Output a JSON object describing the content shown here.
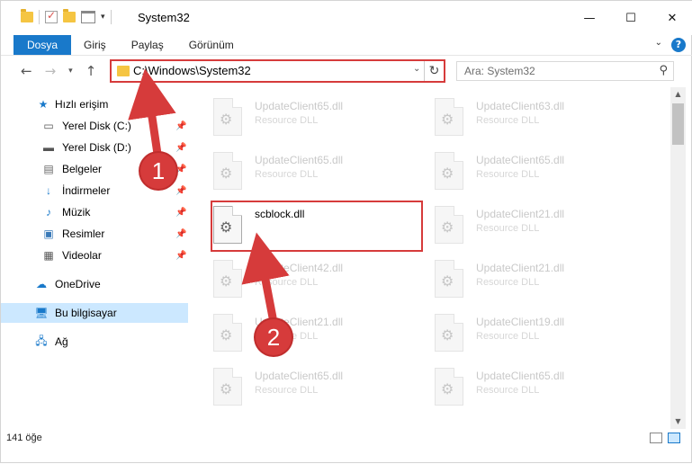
{
  "window": {
    "title": "System32",
    "controls": {
      "minimize": "—",
      "maximize": "☐",
      "close": "✕"
    }
  },
  "ribbon": {
    "tabs": [
      "Dosya",
      "Giriş",
      "Paylaş",
      "Görünüm"
    ],
    "active_tab": "Dosya",
    "accent": "#1979ca"
  },
  "address": {
    "path": "C:\\Windows\\System32",
    "search_placeholder": "Ara: System32"
  },
  "nav": {
    "items": [
      {
        "label": "Hızlı erişim",
        "icon": "star-icon"
      },
      {
        "label": "Yerel Disk (C:)",
        "icon": "drive-icon",
        "pinned": true
      },
      {
        "label": "Yerel Disk (D:)",
        "icon": "drive-icon",
        "pinned": true
      },
      {
        "label": "Belgeler",
        "icon": "documents-icon",
        "pinned": true
      },
      {
        "label": "İndirmeler",
        "icon": "download-icon",
        "pinned": true
      },
      {
        "label": "Müzik",
        "icon": "music-icon",
        "pinned": true
      },
      {
        "label": "Resimler",
        "icon": "pictures-icon",
        "pinned": true
      },
      {
        "label": "Videolar",
        "icon": "videos-icon",
        "pinned": true
      },
      {
        "label": "OneDrive",
        "icon": "cloud-icon"
      },
      {
        "label": "Bu bilgisayar",
        "icon": "computer-icon",
        "selected": true
      },
      {
        "label": "Ağ",
        "icon": "network-icon"
      }
    ]
  },
  "files": [
    {
      "name": "UpdateClient65.dll",
      "type": "Resource DLL"
    },
    {
      "name": "UpdateClient63.dll",
      "type": "Resource DLL"
    },
    {
      "name": "UpdateClient65.dll",
      "type": "Resource DLL"
    },
    {
      "name": "UpdateClient65.dll",
      "type": "Resource DLL"
    },
    {
      "name": "scblock.dll",
      "type": "",
      "highlighted": true
    },
    {
      "name": "UpdateClient21.dll",
      "type": "Resource DLL"
    },
    {
      "name": "UpdateClient42.dll",
      "type": "Resource DLL"
    },
    {
      "name": "UpdateClient21.dll",
      "type": "Resource DLL"
    },
    {
      "name": "UpdateClient21.dll",
      "type": "Resource DLL"
    },
    {
      "name": "UpdateClient19.dll",
      "type": "Resource DLL"
    },
    {
      "name": "UpdateClient65.dll",
      "type": "Resource DLL"
    },
    {
      "name": "UpdateClient65.dll",
      "type": "Resource DLL"
    }
  ],
  "status": {
    "item_count": "141 öğe"
  },
  "annotations": {
    "step1": "1",
    "step2": "2",
    "color": "#d63b3b"
  }
}
